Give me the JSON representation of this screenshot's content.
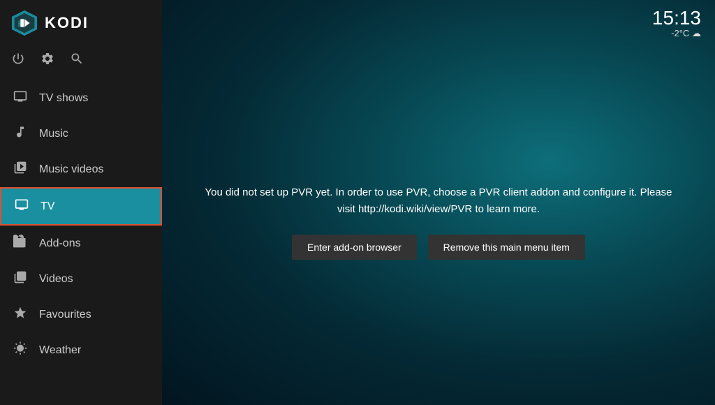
{
  "app": {
    "name": "KODI"
  },
  "clock": {
    "time": "15:13",
    "temperature": "-2°C",
    "weather_icon": "cloud"
  },
  "sidebar": {
    "icons": [
      {
        "name": "power",
        "symbol": "⏻"
      },
      {
        "name": "settings",
        "symbol": "⚙"
      },
      {
        "name": "search",
        "symbol": "🔍"
      }
    ],
    "items": [
      {
        "id": "tv-shows",
        "label": "TV shows",
        "icon": "tv-shows-icon",
        "active": false
      },
      {
        "id": "music",
        "label": "Music",
        "icon": "music-icon",
        "active": false
      },
      {
        "id": "music-videos",
        "label": "Music videos",
        "icon": "music-videos-icon",
        "active": false
      },
      {
        "id": "tv",
        "label": "TV",
        "icon": "tv-icon",
        "active": true
      },
      {
        "id": "add-ons",
        "label": "Add-ons",
        "icon": "addons-icon",
        "active": false
      },
      {
        "id": "videos",
        "label": "Videos",
        "icon": "videos-icon",
        "active": false
      },
      {
        "id": "favourites",
        "label": "Favourites",
        "icon": "favourites-icon",
        "active": false
      },
      {
        "id": "weather",
        "label": "Weather",
        "icon": "weather-icon",
        "active": false
      }
    ]
  },
  "main": {
    "pvr_message": "You did not set up PVR yet. In order to use PVR, choose a PVR client addon and configure it. Please visit http://kodi.wiki/view/PVR to learn more.",
    "button_addon": "Enter add-on browser",
    "button_remove": "Remove this main menu item"
  }
}
